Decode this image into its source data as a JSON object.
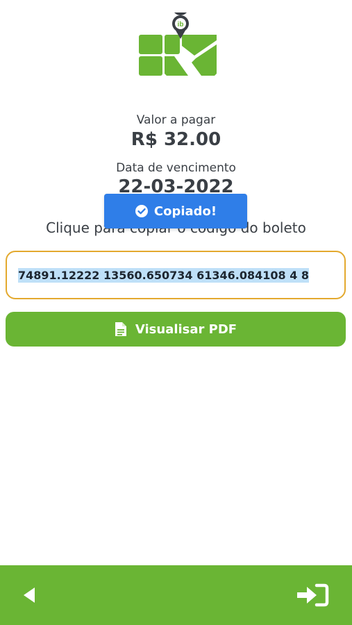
{
  "logo": {
    "badge_text": "ib"
  },
  "payment": {
    "amount_label": "Valor a pagar",
    "amount_value": "R$ 32.00",
    "due_label": "Data de vencimento",
    "due_value": "22-03-2022"
  },
  "toast": {
    "text": "Copiado!",
    "icon": "check-circle-icon"
  },
  "instruction": "Clique para copiar o código do boleto",
  "boleto_code": "74891.12222 13560.650734 61346.084108 4 8",
  "pdf_button": {
    "label": "Visualisar PDF",
    "icon": "file-icon"
  },
  "bottom_bar": {
    "back_icon": "back-arrow-icon",
    "login_icon": "sign-in-icon"
  },
  "colors": {
    "green": "#6ab534",
    "toast_blue": "#2f7ee8",
    "code_border": "#e3a92e",
    "selection": "#bfe0f8"
  }
}
